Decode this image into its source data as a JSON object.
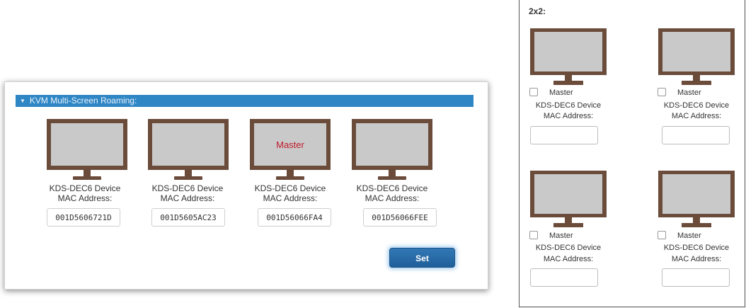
{
  "left": {
    "section_title": "KVM Multi-Screen Roaming:",
    "monitors": [
      {
        "screen_label": "",
        "device_label": "KDS-DEC6 Device",
        "mac_label": "MAC Address:",
        "mac_value": "001D5606721D"
      },
      {
        "screen_label": "",
        "device_label": "KDS-DEC6 Device",
        "mac_label": "MAC Address:",
        "mac_value": "001D5605AC23"
      },
      {
        "screen_label": "Master",
        "device_label": "KDS-DEC6 Device",
        "mac_label": "MAC Address:",
        "mac_value": "001D56066FA4"
      },
      {
        "screen_label": "",
        "device_label": "KDS-DEC6 Device",
        "mac_label": "MAC Address:",
        "mac_value": "001D56066FEE"
      }
    ],
    "set_label": "Set"
  },
  "right": {
    "grid_title": "2x2:",
    "monitors": [
      {
        "master_label": "Master",
        "master_checked": false,
        "device_label": "KDS-DEC6 Device",
        "mac_label": "MAC Address:",
        "mac_value": ""
      },
      {
        "master_label": "Master",
        "master_checked": false,
        "device_label": "KDS-DEC6 Device",
        "mac_label": "MAC Address:",
        "mac_value": ""
      },
      {
        "master_label": "Master",
        "master_checked": false,
        "device_label": "KDS-DEC6 Device",
        "mac_label": "MAC Address:",
        "mac_value": ""
      },
      {
        "master_label": "Master",
        "master_checked": false,
        "device_label": "KDS-DEC6 Device",
        "mac_label": "MAC Address:",
        "mac_value": ""
      }
    ]
  },
  "colors": {
    "monitor_frame": "#6b4c3b",
    "monitor_screen": "#c9c9c9",
    "section_bar": "#2f86c5",
    "master_text": "#c0182a",
    "set_button": "#1f5f99"
  },
  "icons": {
    "section_toggle": "triangle-down-icon",
    "monitor": "monitor-icon"
  }
}
